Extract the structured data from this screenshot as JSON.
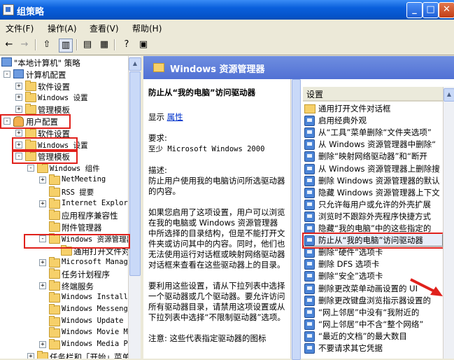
{
  "window": {
    "title": "组策略"
  },
  "menu": [
    "文件(F)",
    "操作(A)",
    "查看(V)",
    "帮助(H)"
  ],
  "toolbar": [
    "back-icon",
    "forward-icon",
    "up-folder-icon",
    "show-tree-icon",
    "properties-icon",
    "export-icon",
    "help-icon",
    "console-icon"
  ],
  "tree": [
    {
      "label": "\"本地计算机\" 策略",
      "indent": 0,
      "icon": "pc"
    },
    {
      "label": "计算机配置",
      "indent": 1,
      "icon": "pc",
      "exp": "-"
    },
    {
      "label": "软件设置",
      "indent": 2,
      "icon": "folder",
      "exp": "+"
    },
    {
      "label": "Windows 设置",
      "indent": 2,
      "icon": "folder",
      "exp": "+"
    },
    {
      "label": "管理模板",
      "indent": 2,
      "icon": "folder",
      "exp": "+"
    },
    {
      "label": "用户配置",
      "indent": 1,
      "icon": "user",
      "exp": "-"
    },
    {
      "label": "软件设置",
      "indent": 2,
      "icon": "folder",
      "exp": "+"
    },
    {
      "label": "Windows 设置",
      "indent": 2,
      "icon": "folder",
      "exp": "+"
    },
    {
      "label": "管理模板",
      "indent": 2,
      "icon": "folder",
      "exp": "-"
    },
    {
      "label": "Windows 组件",
      "indent": 3,
      "icon": "folder",
      "exp": "-"
    },
    {
      "label": "NetMeeting",
      "indent": 4,
      "icon": "folder",
      "exp": "+"
    },
    {
      "label": "RSS 提要",
      "indent": 4,
      "icon": "folder"
    },
    {
      "label": "Internet Explorer",
      "indent": 4,
      "icon": "folder",
      "exp": "+"
    },
    {
      "label": "应用程序兼容性",
      "indent": 4,
      "icon": "folder"
    },
    {
      "label": "附件管理器",
      "indent": 4,
      "icon": "folder"
    },
    {
      "label": "Windows 资源管理器",
      "indent": 4,
      "icon": "folder",
      "exp": "-"
    },
    {
      "label": "通用打开文件对",
      "indent": 5,
      "icon": "folder"
    },
    {
      "label": "Microsoft Manager",
      "indent": 4,
      "icon": "folder",
      "exp": "+"
    },
    {
      "label": "任务计划程序",
      "indent": 4,
      "icon": "folder"
    },
    {
      "label": "终端服务",
      "indent": 4,
      "icon": "folder",
      "exp": "+"
    },
    {
      "label": "Windows Installer",
      "indent": 4,
      "icon": "folder"
    },
    {
      "label": "Windows Messenger",
      "indent": 4,
      "icon": "folder"
    },
    {
      "label": "Windows Update",
      "indent": 4,
      "icon": "folder"
    },
    {
      "label": "Windows Movie Mak",
      "indent": 4,
      "icon": "folder"
    },
    {
      "label": "Windows Media Pla",
      "indent": 4,
      "icon": "folder",
      "exp": "+"
    },
    {
      "label": "任务栏和「开始」菜单",
      "indent": 3,
      "icon": "folder",
      "exp": "+"
    }
  ],
  "header": {
    "title": "Windows 资源管理器"
  },
  "description": {
    "title": "防止从“我的电脑”访问驱动器",
    "display_label": "显示",
    "properties_link": "属性",
    "requirements_label": "要求:",
    "requirements_value": "至少 Microsoft Windows 2000",
    "desc_label": "描述:",
    "desc_text": "防止用户使用我的电脑访问所选驱动器的内容。",
    "para1": "如果您启用了这项设置，用户可以浏览在我的电脑或 Windows 资源管理器中所选择的目录结构，但是不能打开文件夹或访问其中的内容。同时，他们也无法使用运行对话框或映射网络驱动器对话框来查看在这些驱动器上的目录。",
    "para2": "要利用这些设置，请从下拉列表中选择一个驱动器或几个驱动器。要允许访问所有驱动器目录，请禁用这项设置或从下拉列表中选择“不限制驱动器”选项。",
    "para3": "注意: 这些代表指定驱动器的图标"
  },
  "settings": {
    "header": "设置",
    "items": [
      {
        "label": "通用打开文件对话框",
        "icon": "folder"
      },
      {
        "label": "启用经典外观",
        "icon": "policy"
      },
      {
        "label": "从“工具”菜单删除“文件夹选项”",
        "icon": "policy"
      },
      {
        "label": "从 Windows 资源管理器中删除“",
        "icon": "policy"
      },
      {
        "label": "删除“映射网络驱动器”和“断开",
        "icon": "policy"
      },
      {
        "label": "从 Windows 资源管理器上删除搜",
        "icon": "policy"
      },
      {
        "label": "删除 Windows 资源管理器的默认",
        "icon": "policy"
      },
      {
        "label": "隐藏 Windows 资源管理器上下文",
        "icon": "policy"
      },
      {
        "label": "只允许每用户或允许的外壳扩展",
        "icon": "policy"
      },
      {
        "label": "浏览时不跟踪外壳程序快捷方式",
        "icon": "policy"
      },
      {
        "label": "隐藏“我的电脑”中的这些指定的",
        "icon": "policy"
      },
      {
        "label": "防止从“我的电脑”访问驱动器",
        "icon": "policy"
      },
      {
        "label": "删除“硬件”选项卡",
        "icon": "policy"
      },
      {
        "label": "删除 DFS 选项卡",
        "icon": "policy"
      },
      {
        "label": "删除“安全”选项卡",
        "icon": "policy"
      },
      {
        "label": "删除更改菜单动画设置的 UI",
        "icon": "policy"
      },
      {
        "label": "删除更改键盘浏览指示器设置的",
        "icon": "policy"
      },
      {
        "label": "“网上邻居”中没有“我附近的",
        "icon": "policy"
      },
      {
        "label": "“网上邻居”中不含“整个网络”",
        "icon": "policy"
      },
      {
        "label": "“最近的文档”的最大数目",
        "icon": "policy"
      },
      {
        "label": "不要请求其它凭据",
        "icon": "policy"
      }
    ]
  }
}
